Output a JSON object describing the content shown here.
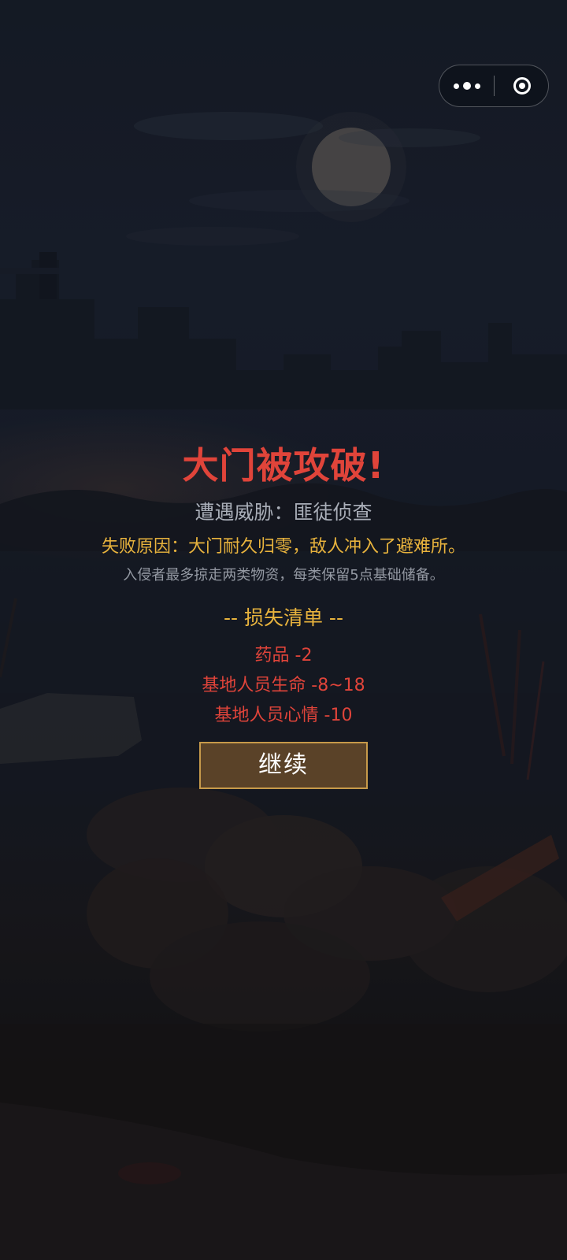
{
  "capsule": {
    "more_icon": "more-dots-icon",
    "close_icon": "target-close-icon"
  },
  "result": {
    "title": "大门被攻破!",
    "threat": "遭遇威胁：匪徒侦查",
    "reason": "失败原因：大门耐久归零，敌人冲入了避难所。",
    "note": "入侵者最多掠走两类物资，每类保留5点基础储备。",
    "loss_title": "-- 损失清单 --",
    "losses": [
      "药品 -2",
      "基地人员生命 -8~18",
      "基地人员心情 -10"
    ],
    "continue_label": "继续"
  },
  "colors": {
    "title_red": "#e0443a",
    "gold": "#e8b33d",
    "button_bg": "#5a4228",
    "button_border": "#c79a4a"
  }
}
